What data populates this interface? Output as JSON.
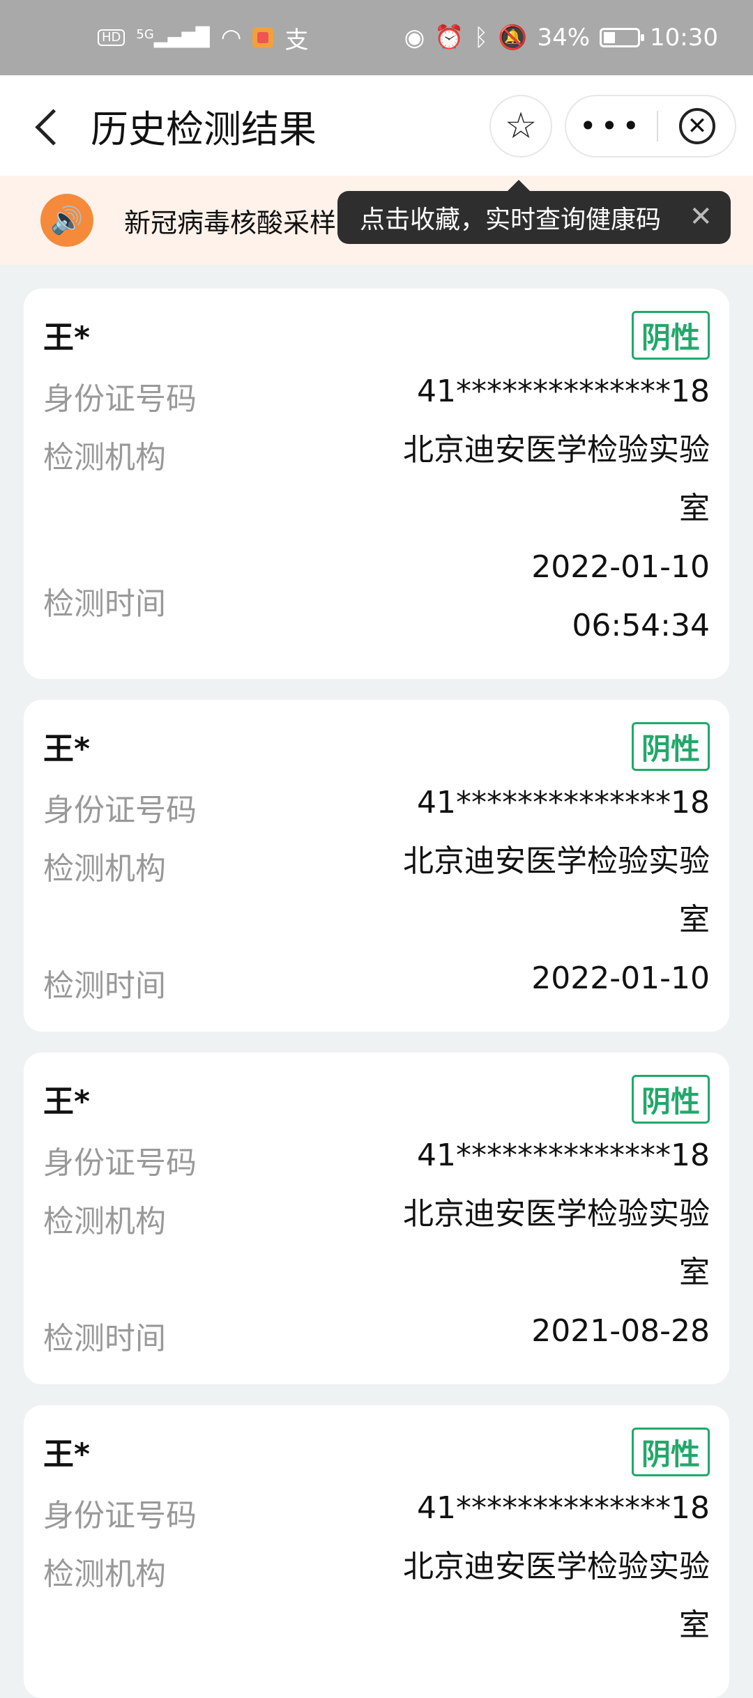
{
  "status_bar": {
    "left_icons": [
      "HD",
      "5G",
      "signal-icon",
      "wifi-icon",
      "app-icon",
      "alipay-icon"
    ],
    "battery": "34%",
    "time": "10:30"
  },
  "header": {
    "title": "历史检测结果",
    "more_label": "•••"
  },
  "notice": {
    "text": "新冠病毒核酸采样点和24小时核酸检测机构"
  },
  "tooltip": {
    "text": "点击收藏，实时查询健康码",
    "close": "✕"
  },
  "cards": [
    {
      "name": "王*",
      "status": "阴性",
      "id_label": "身份证号码",
      "id_value": "41**************18",
      "org_label": "检测机构",
      "org_value_line1": "北京迪安医学检验实验",
      "org_value_line2": "室",
      "time_label": "检测时间",
      "time_value_line1": "2022-01-10",
      "time_value_line2": "06:54:34"
    },
    {
      "name": "王*",
      "status": "阴性",
      "id_label": "身份证号码",
      "id_value": "41**************18",
      "org_label": "检测机构",
      "org_value_line1": "北京迪安医学检验实验",
      "org_value_line2": "室",
      "time_label": "检测时间",
      "time_value_line1": "2022-01-10"
    },
    {
      "name": "王*",
      "status": "阴性",
      "id_label": "身份证号码",
      "id_value": "41**************18",
      "org_label": "检测机构",
      "org_value_line1": "北京迪安医学检验实验",
      "org_value_line2": "室",
      "time_label": "检测时间",
      "time_value_line1": "2021-08-28"
    },
    {
      "name": "王*",
      "status": "阴性",
      "id_label": "身份证号码",
      "id_value": "41**************18",
      "org_label": "检测机构",
      "org_value_line1": "北京迪安医学检验实验",
      "org_value_line2": "室"
    }
  ]
}
